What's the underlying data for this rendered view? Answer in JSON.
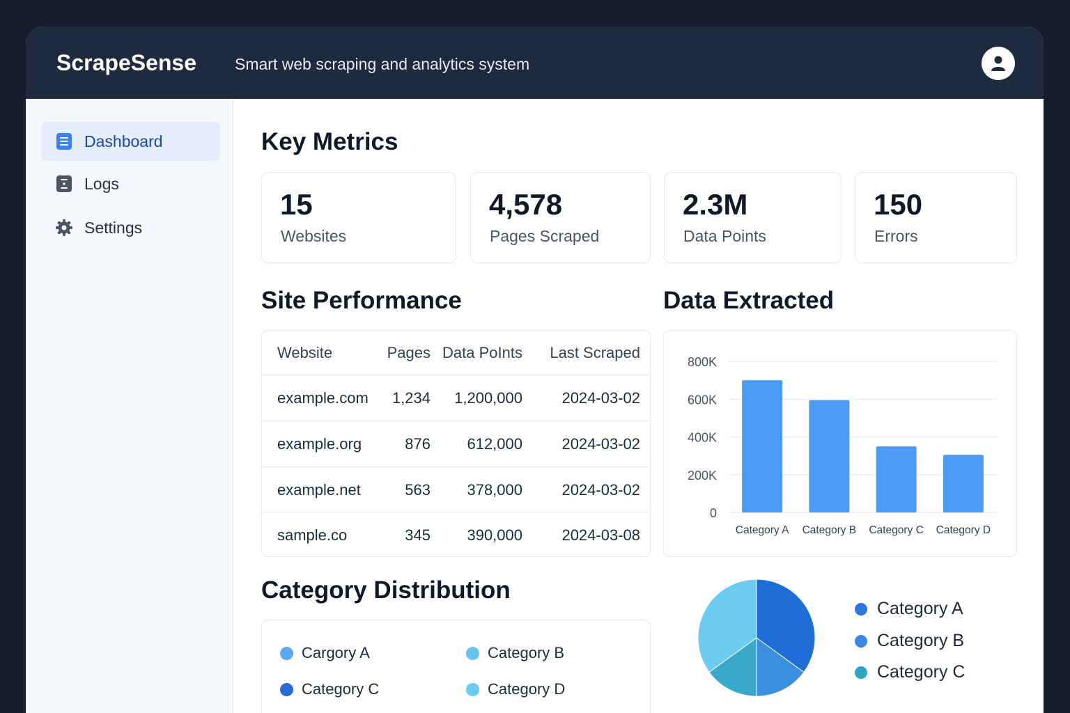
{
  "app": {
    "brand": "ScrapeSense",
    "tagline": "Smart web scraping and analytics system",
    "avatar_icon": "user-icon"
  },
  "sidebar": {
    "items": [
      {
        "label": "Dashboard",
        "icon": "document-icon",
        "active": true
      },
      {
        "label": "Logs",
        "icon": "log-icon",
        "active": false
      },
      {
        "label": "Settings",
        "icon": "gear-icon",
        "active": false
      }
    ]
  },
  "metrics": {
    "title": "Key Metrics",
    "cards": [
      {
        "value": "15",
        "label": "Websites"
      },
      {
        "value": "4,578",
        "label": "Pages Scraped"
      },
      {
        "value": "2.3M",
        "label": "Data Points"
      },
      {
        "value": "150",
        "label": "Errors"
      }
    ]
  },
  "site_performance": {
    "title": "Site Performance",
    "headers": [
      "Website",
      "Pages",
      "Data PoInts",
      "Last Scraped"
    ],
    "rows": [
      [
        "example.com",
        "1,234",
        "1,200,000",
        "2024-03-02"
      ],
      [
        "example.org",
        "876",
        "612,000",
        "2024-03-02"
      ],
      [
        "example.net",
        "563",
        "378,000",
        "2024-03-02"
      ],
      [
        "sample.co",
        "345",
        "390,000",
        "2024-03-08"
      ]
    ]
  },
  "data_extracted": {
    "title": "Data Extracted"
  },
  "category_distribution": {
    "title": "Category Distribution",
    "legend": [
      {
        "label": "Cargory A",
        "color": "#5aa9ef"
      },
      {
        "label": "Category B",
        "color": "#66c4ec"
      },
      {
        "label": "Category C",
        "color": "#2a6bd8"
      },
      {
        "label": "Category D",
        "color": "#6ccaee"
      }
    ],
    "pie_legend": [
      {
        "label": "Category A",
        "color": "#2f73dc"
      },
      {
        "label": "Category B",
        "color": "#3a86e4"
      },
      {
        "label": "Category C",
        "color": "#2fa6c4"
      }
    ]
  },
  "chart_data": [
    {
      "type": "bar",
      "categories": [
        "Category A",
        "Category B",
        "Category C",
        "Category D"
      ],
      "values": [
        700000,
        595000,
        350000,
        305000
      ],
      "yticks": [
        "0",
        "200K",
        "400K",
        "600K",
        "800K"
      ],
      "ylim": [
        0,
        800000
      ],
      "grid": true,
      "color": "#4b9bf7"
    },
    {
      "type": "pie",
      "values": [
        35,
        15,
        15,
        35
      ],
      "colors": [
        "#1f6ed6",
        "#3b8fe0",
        "#3aa8cb",
        "#6ccbf0"
      ]
    }
  ]
}
